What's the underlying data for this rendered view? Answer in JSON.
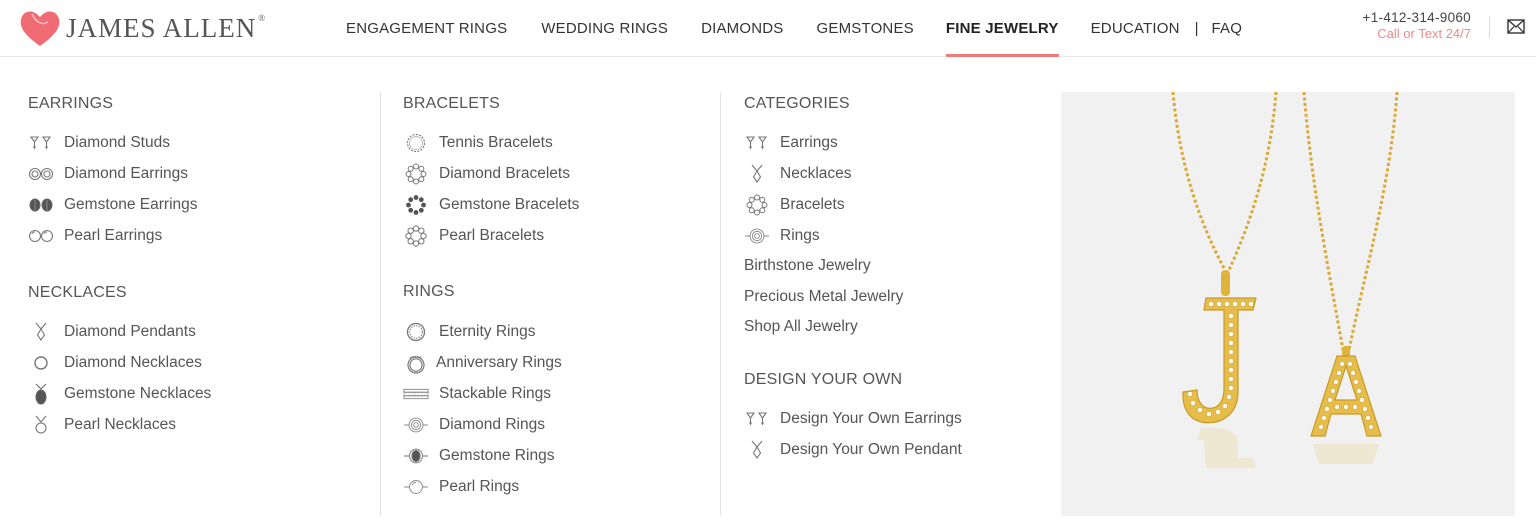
{
  "brand": {
    "name": "JAMES ALLEN",
    "mark": "®"
  },
  "nav": {
    "items": [
      "ENGAGEMENT RINGS",
      "WEDDING RINGS",
      "DIAMONDS",
      "GEMSTONES",
      "FINE JEWELRY",
      "EDUCATION"
    ],
    "separator": "|",
    "faq": "FAQ",
    "active": "FINE JEWELRY"
  },
  "contact": {
    "phone": "+1-412-314-9060",
    "call_text": "Call or Text 24/7",
    "accent": "#f08a8a"
  },
  "menu": {
    "earrings": {
      "title": "EARRINGS",
      "items": [
        "Diamond Studs",
        "Diamond Earrings",
        "Gemstone Earrings",
        "Pearl Earrings"
      ]
    },
    "necklaces": {
      "title": "NECKLACES",
      "items": [
        "Diamond Pendants",
        "Diamond Necklaces",
        "Gemstone Necklaces",
        "Pearl Necklaces"
      ]
    },
    "bracelets": {
      "title": "BRACELETS",
      "items": [
        "Tennis Bracelets",
        "Diamond Bracelets",
        "Gemstone Bracelets",
        "Pearl Bracelets"
      ]
    },
    "rings": {
      "title": "RINGS",
      "items": [
        "Eternity Rings",
        "Anniversary Rings",
        "Stackable Rings",
        "Diamond Rings",
        "Gemstone Rings",
        "Pearl Rings"
      ]
    },
    "categories": {
      "title": "CATEGORIES",
      "items": [
        "Earrings",
        "Necklaces",
        "Bracelets",
        "Rings"
      ],
      "links": [
        "Birthstone Jewelry",
        "Precious Metal Jewelry",
        "Shop All Jewelry"
      ]
    },
    "design_your_own": {
      "title": "DESIGN YOUR OWN",
      "items": [
        "Design Your Own Earrings",
        "Design Your Own Pendant"
      ]
    }
  },
  "promo": {
    "letters": [
      "J",
      "A"
    ],
    "metal_color": "#e0b43c"
  },
  "colors": {
    "brand_pink": "#f06b73",
    "active_underline": "#f07b7b"
  }
}
